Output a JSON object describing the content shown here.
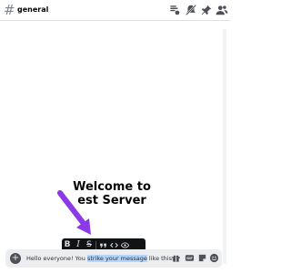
{
  "header": {
    "channel_name": "general",
    "icons": [
      "threads-icon",
      "bell-muted-icon",
      "pin-icon",
      "members-icon"
    ]
  },
  "welcome": {
    "title_line1": "Welcome to",
    "title_line2": "est Server"
  },
  "format_toolbar": {
    "bold": "B",
    "italic": "I",
    "strikethrough": "S"
  },
  "composer": {
    "plus": "+",
    "text_before": "Hello everyone! You ",
    "text_selected": "strike your message",
    "text_after": " like this."
  },
  "colors": {
    "annotation_arrow": "#8a3ae6",
    "selection_highlight": "#b3d4fb",
    "toolbar_bg": "#111214"
  }
}
